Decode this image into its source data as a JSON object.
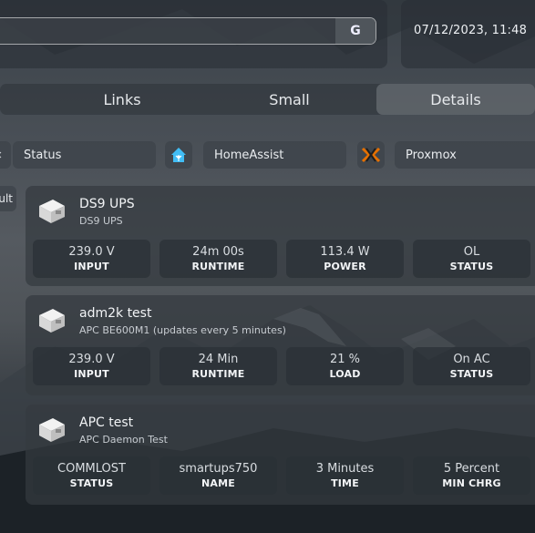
{
  "header": {
    "datetime": "07/12/2023, 11:48",
    "search_button_label": "G"
  },
  "tabs": [
    {
      "label": "Links",
      "active": false
    },
    {
      "label": "Small",
      "active": false
    },
    {
      "label": "Details",
      "active": true
    }
  ],
  "bookmarks": [
    {
      "label": "Status",
      "icon": "status-icon"
    },
    {
      "label": "HomeAssist",
      "icon": "home-assistant-icon"
    },
    {
      "label": "Proxmox",
      "icon": "proxmox-icon"
    }
  ],
  "side_button_label": "ult",
  "cards": [
    {
      "title": "DS9 UPS",
      "subtitle": "DS9 UPS",
      "icon": "ups-icon",
      "stats": [
        {
          "value": "239.0 V",
          "label": "INPUT"
        },
        {
          "value": "24m 00s",
          "label": "RUNTIME"
        },
        {
          "value": "113.4 W",
          "label": "POWER"
        },
        {
          "value": "OL",
          "label": "STATUS"
        }
      ]
    },
    {
      "title": "adm2k test",
      "subtitle": "APC BE600M1 (updates every 5 minutes)",
      "icon": "ups-icon",
      "stats": [
        {
          "value": "239.0 V",
          "label": "INPUT"
        },
        {
          "value": "24 Min",
          "label": "RUNTIME"
        },
        {
          "value": "21 %",
          "label": "LOAD"
        },
        {
          "value": "On AC",
          "label": "STATUS"
        }
      ]
    },
    {
      "title": "APC test",
      "subtitle": "APC Daemon Test",
      "icon": "ups-icon",
      "stats": [
        {
          "value": "COMMLOST",
          "label": "STATUS"
        },
        {
          "value": "smartups750",
          "label": "NAME"
        },
        {
          "value": "3 Minutes",
          "label": "TIME"
        },
        {
          "value": "5 Percent",
          "label": "MIN CHRG"
        }
      ]
    }
  ],
  "colors": {
    "accent_proxmox": "#e57000",
    "home_assistant": "#41bdf5"
  }
}
